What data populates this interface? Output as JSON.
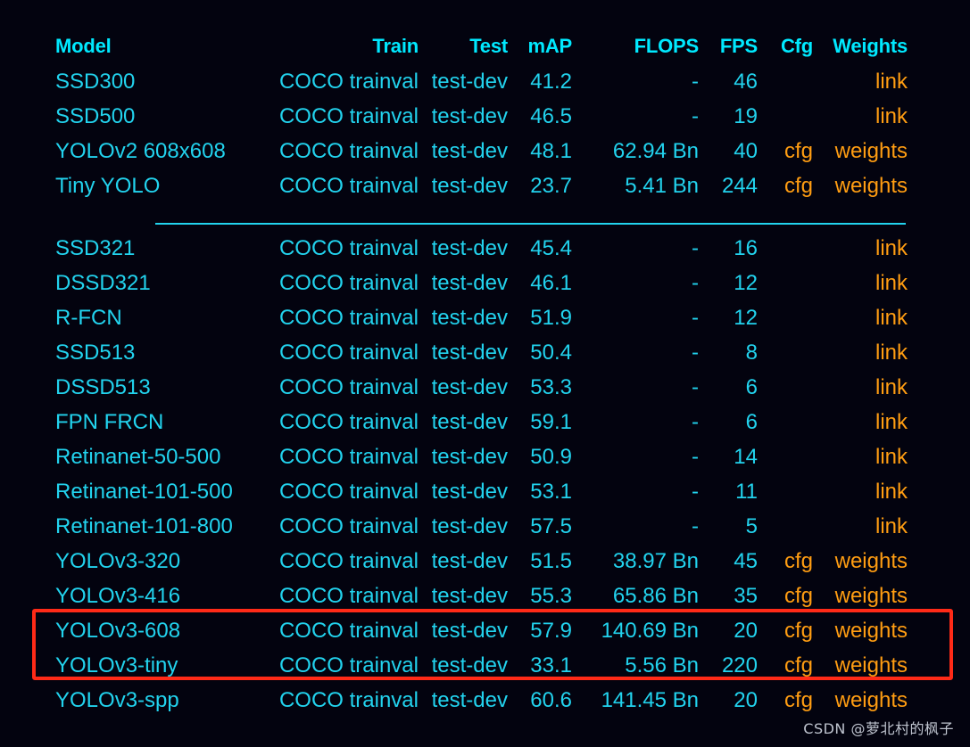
{
  "colors": {
    "background": "#03030f",
    "header_text": "#00e9ff",
    "cell_text": "#22d3ee",
    "link_text": "#ff9d12",
    "highlight_border": "#ff2a17",
    "separator": "#22d3ee",
    "watermark_text": "#bfc4cf"
  },
  "table": {
    "columns": [
      {
        "key": "model",
        "label": "Model",
        "align": "left"
      },
      {
        "key": "train",
        "label": "Train",
        "align": "right"
      },
      {
        "key": "test",
        "label": "Test",
        "align": "right"
      },
      {
        "key": "map",
        "label": "mAP",
        "align": "right"
      },
      {
        "key": "flops",
        "label": "FLOPS",
        "align": "right"
      },
      {
        "key": "fps",
        "label": "FPS",
        "align": "right"
      },
      {
        "key": "cfg",
        "label": "Cfg",
        "align": "right"
      },
      {
        "key": "weights",
        "label": "Weights",
        "align": "right"
      }
    ],
    "groups": [
      {
        "rows": [
          {
            "model": "SSD300",
            "train": "COCO trainval",
            "test": "test-dev",
            "map": "41.2",
            "flops": "-",
            "fps": "46",
            "cfg": "",
            "weights": "link"
          },
          {
            "model": "SSD500",
            "train": "COCO trainval",
            "test": "test-dev",
            "map": "46.5",
            "flops": "-",
            "fps": "19",
            "cfg": "",
            "weights": "link"
          },
          {
            "model": "YOLOv2 608x608",
            "train": "COCO trainval",
            "test": "test-dev",
            "map": "48.1",
            "flops": "62.94 Bn",
            "fps": "40",
            "cfg": "cfg",
            "weights": "weights"
          },
          {
            "model": "Tiny YOLO",
            "train": "COCO trainval",
            "test": "test-dev",
            "map": "23.7",
            "flops": "5.41 Bn",
            "fps": "244",
            "cfg": "cfg",
            "weights": "weights"
          }
        ]
      },
      {
        "rows": [
          {
            "model": "SSD321",
            "train": "COCO trainval",
            "test": "test-dev",
            "map": "45.4",
            "flops": "-",
            "fps": "16",
            "cfg": "",
            "weights": "link"
          },
          {
            "model": "DSSD321",
            "train": "COCO trainval",
            "test": "test-dev",
            "map": "46.1",
            "flops": "-",
            "fps": "12",
            "cfg": "",
            "weights": "link"
          },
          {
            "model": "R-FCN",
            "train": "COCO trainval",
            "test": "test-dev",
            "map": "51.9",
            "flops": "-",
            "fps": "12",
            "cfg": "",
            "weights": "link"
          },
          {
            "model": "SSD513",
            "train": "COCO trainval",
            "test": "test-dev",
            "map": "50.4",
            "flops": "-",
            "fps": "8",
            "cfg": "",
            "weights": "link"
          },
          {
            "model": "DSSD513",
            "train": "COCO trainval",
            "test": "test-dev",
            "map": "53.3",
            "flops": "-",
            "fps": "6",
            "cfg": "",
            "weights": "link"
          },
          {
            "model": "FPN FRCN",
            "train": "COCO trainval",
            "test": "test-dev",
            "map": "59.1",
            "flops": "-",
            "fps": "6",
            "cfg": "",
            "weights": "link"
          },
          {
            "model": "Retinanet-50-500",
            "train": "COCO trainval",
            "test": "test-dev",
            "map": "50.9",
            "flops": "-",
            "fps": "14",
            "cfg": "",
            "weights": "link"
          },
          {
            "model": "Retinanet-101-500",
            "train": "COCO trainval",
            "test": "test-dev",
            "map": "53.1",
            "flops": "-",
            "fps": "11",
            "cfg": "",
            "weights": "link"
          },
          {
            "model": "Retinanet-101-800",
            "train": "COCO trainval",
            "test": "test-dev",
            "map": "57.5",
            "flops": "-",
            "fps": "5",
            "cfg": "",
            "weights": "link"
          },
          {
            "model": "YOLOv3-320",
            "train": "COCO trainval",
            "test": "test-dev",
            "map": "51.5",
            "flops": "38.97 Bn",
            "fps": "45",
            "cfg": "cfg",
            "weights": "weights"
          },
          {
            "model": "YOLOv3-416",
            "train": "COCO trainval",
            "test": "test-dev",
            "map": "55.3",
            "flops": "65.86 Bn",
            "fps": "35",
            "cfg": "cfg",
            "weights": "weights"
          },
          {
            "model": "YOLOv3-608",
            "train": "COCO trainval",
            "test": "test-dev",
            "map": "57.9",
            "flops": "140.69 Bn",
            "fps": "20",
            "cfg": "cfg",
            "weights": "weights"
          },
          {
            "model": "YOLOv3-tiny",
            "train": "COCO trainval",
            "test": "test-dev",
            "map": "33.1",
            "flops": "5.56 Bn",
            "fps": "220",
            "cfg": "cfg",
            "weights": "weights"
          },
          {
            "model": "YOLOv3-spp",
            "train": "COCO trainval",
            "test": "test-dev",
            "map": "60.6",
            "flops": "141.45 Bn",
            "fps": "20",
            "cfg": "cfg",
            "weights": "weights"
          }
        ]
      }
    ]
  },
  "annotation": {
    "highlighted_models": [
      "YOLOv3-608",
      "YOLOv3-tiny"
    ]
  },
  "watermark": {
    "text": "CSDN @萝北村的枫子"
  }
}
